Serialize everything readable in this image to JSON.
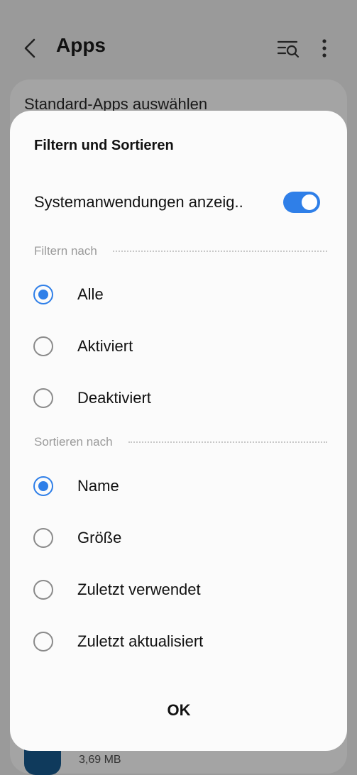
{
  "appbar": {
    "title": "Apps",
    "back_icon": "back-arrow-icon",
    "search_icon": "filter-search-icon",
    "more_icon": "more-vertical-icon"
  },
  "background": {
    "row_title": "Standard-Apps auswählen",
    "app_size": "3,69 MB"
  },
  "dialog": {
    "title": "Filtern und Sortieren",
    "system_apps_label": "Systemanwendungen anzeig..",
    "system_apps_enabled": true,
    "filter_section": "Filtern nach",
    "filter_options": [
      {
        "label": "Alle",
        "selected": true
      },
      {
        "label": "Aktiviert",
        "selected": false
      },
      {
        "label": "Deaktiviert",
        "selected": false
      }
    ],
    "sort_section": "Sortieren nach",
    "sort_options": [
      {
        "label": "Name",
        "selected": true
      },
      {
        "label": "Größe",
        "selected": false
      },
      {
        "label": "Zuletzt verwendet",
        "selected": false
      },
      {
        "label": "Zuletzt aktualisiert",
        "selected": false
      }
    ],
    "ok_label": "OK"
  },
  "colors": {
    "accent": "#2f7fe8",
    "scrim_background": "#9a9a9a",
    "dialog_background": "#fbfbfb"
  }
}
